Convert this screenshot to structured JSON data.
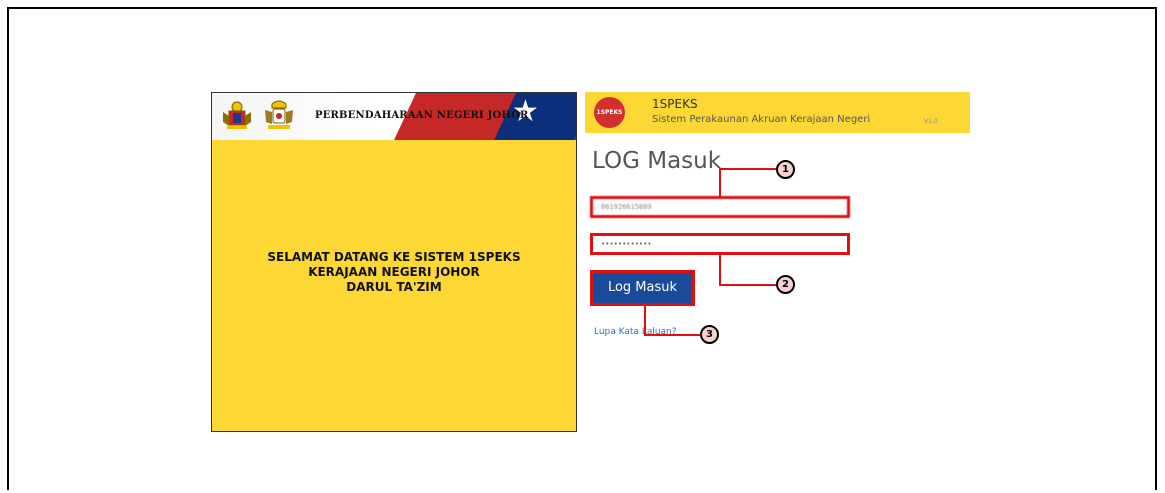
{
  "welcome_panel": {
    "banner_title": "PERBENDAHARAAN NEGERI JOHOR",
    "welcome_lines": [
      "SELAMAT DATANG KE SISTEM 1SPEKS",
      "KERAJAAN NEGERI JOHOR",
      "DARUL TA'ZIM"
    ]
  },
  "app_header": {
    "logo_text": "1SPEKS",
    "name": "1SPEKS",
    "subtitle": "Sistem Perakaunan Akruan Kerajaan Negeri",
    "version": "V1.0"
  },
  "login": {
    "title": "LOG Masuk",
    "username_value": "061926615889",
    "password_value": "••••••••••••",
    "button_label": "Log Masuk",
    "forgot_link": "Lupa Kata Laluan?"
  },
  "callouts": {
    "one": "1",
    "two": "2",
    "three": "3"
  },
  "colors": {
    "panel_yellow": "#fdd835",
    "highlight_red": "#e01010",
    "button_blue": "#1a4a9a",
    "link_blue": "#2a6fc4"
  },
  "icons": {
    "crest_left": "malaysia-coat-of-arms-icon",
    "crest_right": "johor-coat-of-arms-icon",
    "star": "star-icon"
  }
}
